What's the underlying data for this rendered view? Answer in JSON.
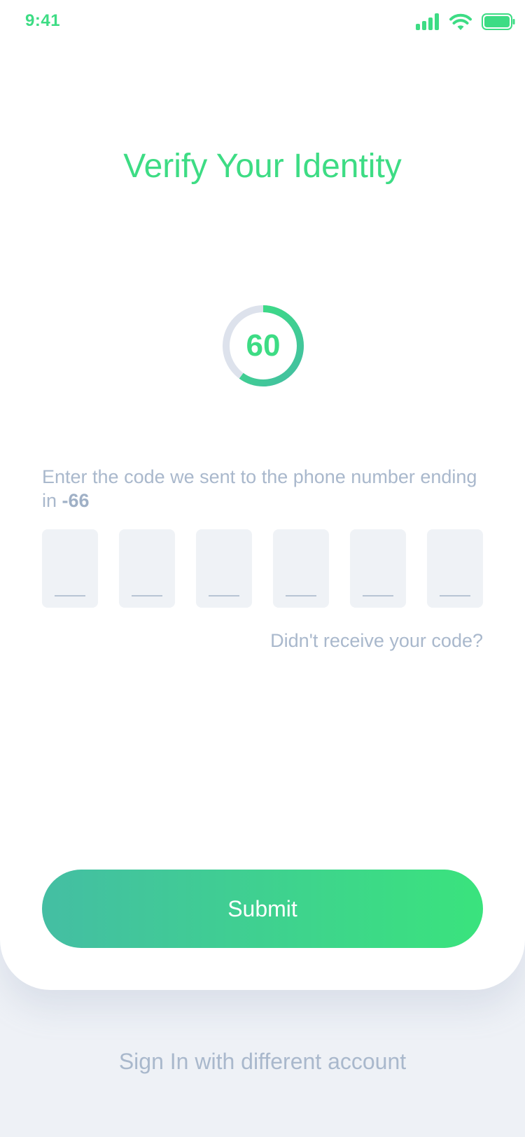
{
  "status_bar": {
    "time": "9:41",
    "icons": [
      "signal-icon",
      "wifi-icon",
      "battery-icon"
    ]
  },
  "header": {
    "title": "Verify Your Identity"
  },
  "timer": {
    "value": "60",
    "progress": 0.6
  },
  "instruction": {
    "text": "Enter the code we sent to the phone number ending in ",
    "phone_suffix": "-66"
  },
  "code_input": {
    "digits": [
      "",
      "",
      "",
      "",
      "",
      ""
    ]
  },
  "links": {
    "resend": "Didn't receive your code?",
    "switch_account": "Sign In with different account"
  },
  "actions": {
    "submit_label": "Submit"
  },
  "colors": {
    "accent": "#3ddc84",
    "gradient_start": "#44bea3",
    "gradient_end": "#3ae37d",
    "muted_text": "#a9b8cc",
    "page_background": "#eef1f6",
    "input_background": "#eff2f6",
    "timer_track": "#dde2ec"
  }
}
